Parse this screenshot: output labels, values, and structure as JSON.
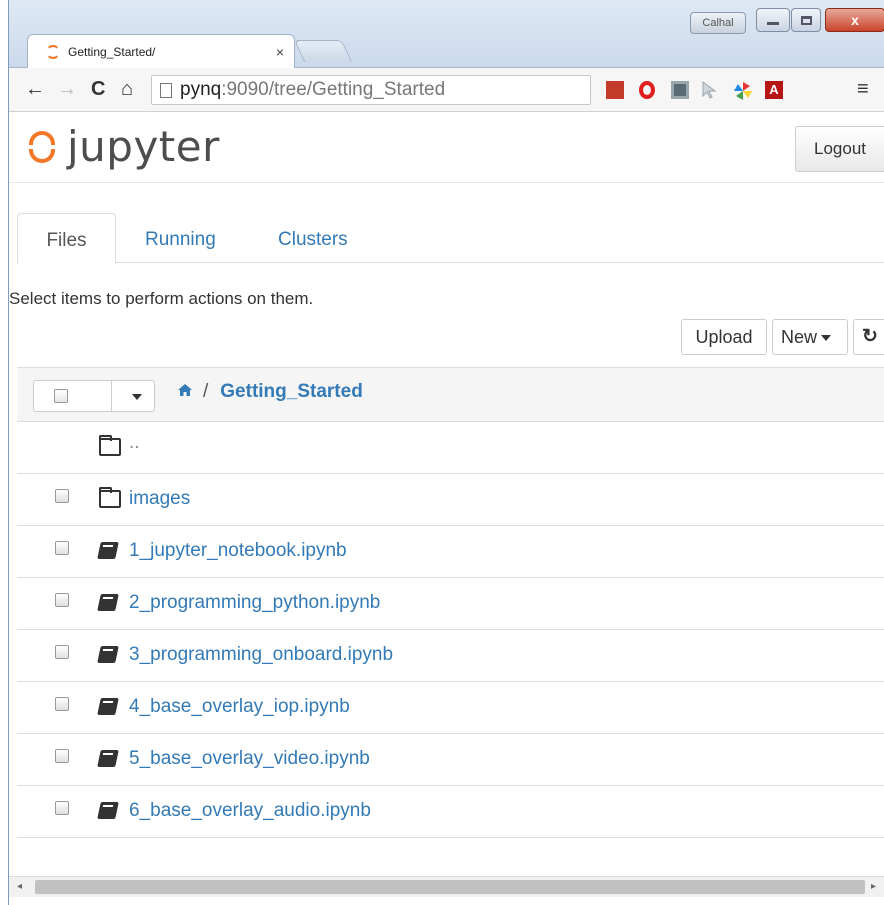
{
  "browser": {
    "user_badge": "Calhal",
    "tab": {
      "title": "Getting_Started/",
      "close": "×"
    },
    "nav": {
      "back": "←",
      "forward": "→",
      "reload": "C",
      "home": "⌂"
    },
    "url": {
      "host": "pynq",
      "path": ":9090/tree/Getting_Started"
    },
    "window": {
      "minimize": "",
      "maximize": "",
      "close": "x"
    },
    "extensions": [
      "bookmark-extension",
      "opera-extension",
      "screenshot-extension",
      "cursor-extension",
      "pinwheel-extension",
      "acrobat-extension"
    ],
    "acrobat_glyph": "A",
    "menu": "≡"
  },
  "jupyter": {
    "logo_text": "jupyter",
    "logout_label": "Logout",
    "tabs": [
      {
        "label": "Files",
        "active": true
      },
      {
        "label": "Running",
        "active": false
      },
      {
        "label": "Clusters",
        "active": false
      }
    ],
    "hint": "Select items to perform actions on them.",
    "buttons": {
      "upload": "Upload",
      "new": "New",
      "refresh": "↻"
    },
    "breadcrumb": {
      "separator": "/",
      "current": "Getting_Started"
    },
    "rows": [
      {
        "name": "..",
        "type": "up"
      },
      {
        "name": "images",
        "type": "folder"
      },
      {
        "name": "1_jupyter_notebook.ipynb",
        "type": "notebook"
      },
      {
        "name": "2_programming_python.ipynb",
        "type": "notebook"
      },
      {
        "name": "3_programming_onboard.ipynb",
        "type": "notebook"
      },
      {
        "name": "4_base_overlay_iop.ipynb",
        "type": "notebook"
      },
      {
        "name": "5_base_overlay_video.ipynb",
        "type": "notebook"
      },
      {
        "name": "6_base_overlay_audio.ipynb",
        "type": "notebook"
      }
    ]
  },
  "colors": {
    "accent": "#f37726",
    "link": "#337ab7"
  }
}
